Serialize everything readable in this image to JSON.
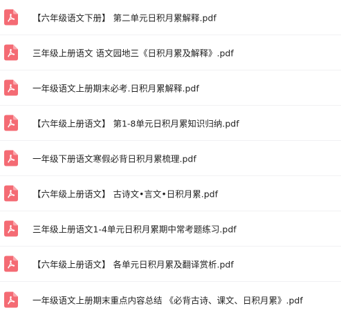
{
  "file_list": {
    "icon": "pdf-file-icon",
    "icon_color": "#f46b74",
    "items": [
      {
        "name": "【六年级语文下册】 第二单元日积月累解释.pdf"
      },
      {
        "name": "三年级上册语文 语文园地三《日积月累及解释》.pdf"
      },
      {
        "name": "一年级语文上册期末必考.日积月累解释.pdf"
      },
      {
        "name": "【六年级上册语文】 第1-8单元日积月累知识归纳.pdf"
      },
      {
        "name": "一年级下册语文寒假必背日积月累梳理.pdf"
      },
      {
        "name": "【六年级上册语文】 古诗文•言文•日积月累.pdf"
      },
      {
        "name": "三年级上册语文1-4单元日积月累期中常考题练习.pdf"
      },
      {
        "name": "【六年级上册语文】 各单元日积月累及翻译赏析.pdf"
      },
      {
        "name": "一年级语文上册期末重点内容总结 《必背古诗、课文、日积月累》.pdf"
      }
    ]
  }
}
